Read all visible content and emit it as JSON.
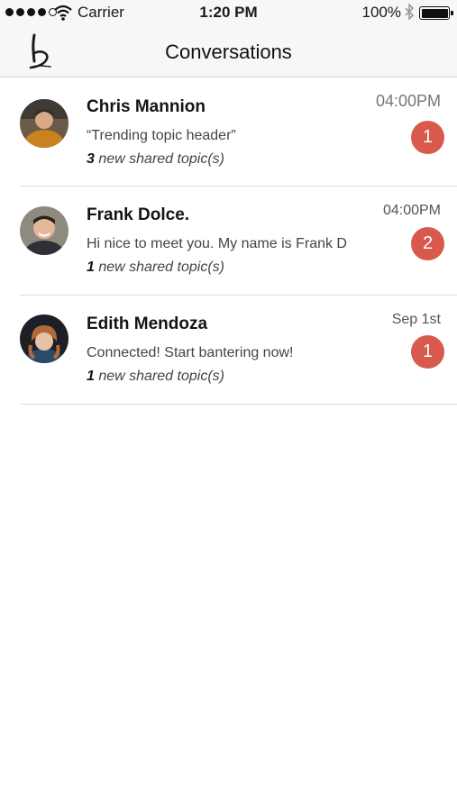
{
  "status_bar": {
    "carrier": "Carrier",
    "time": "1:20 PM",
    "battery_percent": "100%",
    "signal_bars_filled": 4,
    "signal_bars_total": 5,
    "icons": [
      "wifi-icon",
      "bluetooth-icon",
      "battery-icon"
    ]
  },
  "nav": {
    "title": "Conversations",
    "logo_icon": "app-logo-icon"
  },
  "colors": {
    "badge": "#d85a4c",
    "nav_background": "#f7f7f7",
    "separator": "#dcdcdc"
  },
  "conversations": [
    {
      "name": "Chris Mannion",
      "preview": "“Trending topic header”",
      "topic_count": "3",
      "topics_suffix": " new shared topic(s)",
      "time": "04:00PM",
      "unread": "1"
    },
    {
      "name": "Frank Dolce.",
      "preview": "Hi nice to meet you. My name is Frank D",
      "topic_count": "1",
      "topics_suffix": " new shared topic(s)",
      "time": "04:00PM",
      "unread": "2"
    },
    {
      "name": "Edith Mendoza",
      "preview": "Connected! Start bantering now!",
      "topic_count": "1",
      "topics_suffix": " new shared topic(s)",
      "time": "Sep 1st",
      "unread": "1"
    }
  ]
}
